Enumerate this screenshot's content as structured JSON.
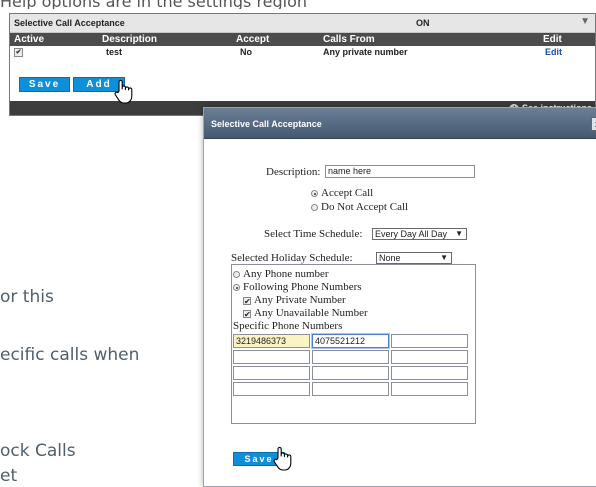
{
  "background_text": {
    "line1": "or this",
    "line2": "ecific calls when",
    "line3": "ock Calls",
    "line4": "et"
  },
  "panel": {
    "title": "Selective Call Acceptance",
    "status": "ON",
    "columns": {
      "active": "Active",
      "description": "Description",
      "accept": "Accept",
      "calls_from": "Calls From",
      "edit": "Edit"
    },
    "row": {
      "active_checked": true,
      "description": "test",
      "accept": "No",
      "calls_from": "Any private number",
      "edit": "Edit"
    },
    "save_label": "Save",
    "add_label": "Add",
    "footer_link": "See instructions"
  },
  "dialog": {
    "title": "Selective Call Acceptance",
    "close_label": "x",
    "description_label": "Description:",
    "description_value": "name here",
    "accept_call_label": "Accept Call",
    "do_not_accept_label": "Do Not Accept Call",
    "accept_selected": "accept",
    "time_schedule_label": "Select Time Schedule:",
    "time_schedule_value": "Every Day All Day",
    "holiday_schedule_label": "Selected Holiday Schedule:",
    "holiday_schedule_value": "None",
    "any_phone_label": "Any Phone number",
    "following_label": "Following Phone Numbers",
    "phone_mode_selected": "following",
    "any_private_label": "Any Private Number",
    "any_private_checked": true,
    "any_unavailable_label": "Any Unavailable Number",
    "any_unavailable_checked": true,
    "specific_numbers_label": "Specific Phone Numbers",
    "phone_numbers": [
      "3219486373",
      "4075521212",
      "",
      "",
      "",
      "",
      "",
      "",
      "",
      "",
      "",
      ""
    ],
    "save_label": "Save"
  }
}
